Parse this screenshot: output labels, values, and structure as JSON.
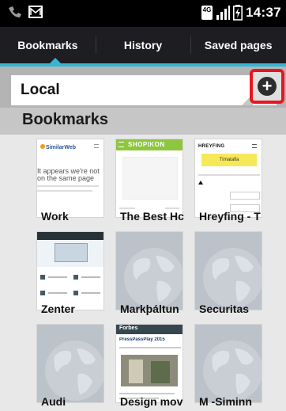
{
  "status_bar": {
    "network": "4G",
    "time": "14:37"
  },
  "tabs": [
    {
      "label": "Bookmarks",
      "selected": true
    },
    {
      "label": "History",
      "selected": false
    },
    {
      "label": "Saved pages",
      "selected": false
    }
  ],
  "folder": {
    "label": "Local"
  },
  "section": {
    "title": "Bookmarks"
  },
  "bookmarks": [
    {
      "label": "Work",
      "thumb": "similarweb",
      "thumb_text": {
        "brand": "SimilarWeb",
        "headline": "It appears we're not on the same page"
      }
    },
    {
      "label": "The Best Hc",
      "thumb": "shopikon",
      "thumb_text": {
        "brand": "SHOPIKON"
      }
    },
    {
      "label": "Hreyfing - T",
      "thumb": "hreyfing",
      "thumb_text": {
        "brand": "HREYFING",
        "button": "Tímatafla"
      }
    },
    {
      "label": "Zenter",
      "thumb": "zenter"
    },
    {
      "label": "Markþáltun",
      "thumb": "globe"
    },
    {
      "label": "Securitas",
      "thumb": "globe"
    },
    {
      "label": "Audi",
      "thumb": "globe"
    },
    {
      "label": "Design mov",
      "thumb": "forbes",
      "thumb_text": {
        "brand": "Forbes",
        "headline": "PressPassPlay 2015"
      }
    },
    {
      "label": "M -Siminn",
      "thumb": "globe"
    }
  ],
  "colors": {
    "accent": "#35b6d4",
    "highlight_box": "#e8161f",
    "tab_bar": "#1e1e22"
  }
}
